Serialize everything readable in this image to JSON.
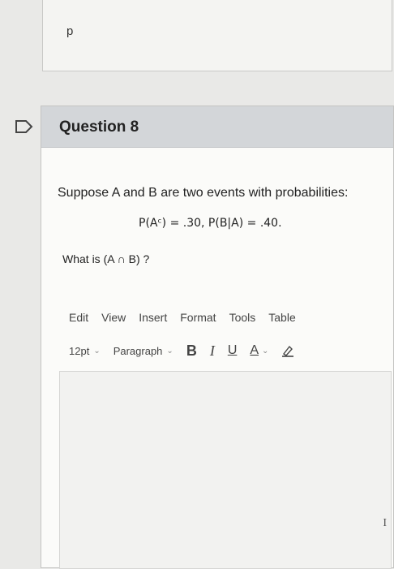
{
  "previous_answer": {
    "text": "p"
  },
  "question": {
    "title": "Question 8",
    "prompt": "Suppose A and B are two events with probabilities:",
    "formula": "P(Aᶜ) = .30,  P(B|A) = .40.",
    "subquestion": "What is (A ∩ B) ?"
  },
  "editor": {
    "menu": [
      "Edit",
      "View",
      "Insert",
      "Format",
      "Tools",
      "Table"
    ],
    "font_size": "12pt",
    "block_format": "Paragraph",
    "format_buttons": {
      "bold": "B",
      "italic": "I",
      "underline": "U",
      "text_color": "A"
    },
    "content": ""
  },
  "icons": {
    "flag": "flag-outline-icon",
    "chevron": "chevron-down-icon",
    "highlight": "highlighter-icon",
    "cursor": "text-cursor-icon"
  }
}
